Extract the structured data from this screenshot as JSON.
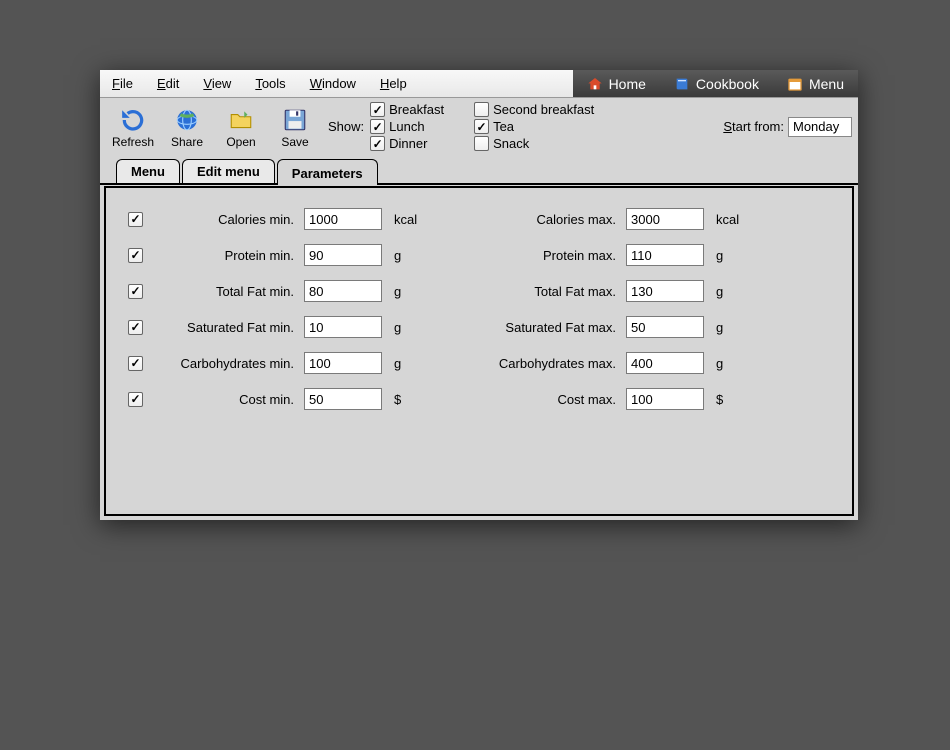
{
  "menubar": {
    "items": [
      {
        "label": "File",
        "u": "F"
      },
      {
        "label": "Edit",
        "u": "E"
      },
      {
        "label": "View",
        "u": "V"
      },
      {
        "label": "Tools",
        "u": "T"
      },
      {
        "label": "Window",
        "u": "W"
      },
      {
        "label": "Help",
        "u": "H"
      }
    ],
    "right": [
      {
        "label": "Home",
        "icon": "home"
      },
      {
        "label": "Cookbook",
        "icon": "book"
      },
      {
        "label": "Menu",
        "icon": "calendar"
      }
    ]
  },
  "toolbar": {
    "buttons": [
      {
        "label": "Refresh",
        "icon": "refresh"
      },
      {
        "label": "Share",
        "icon": "globe"
      },
      {
        "label": "Open",
        "icon": "folder"
      },
      {
        "label": "Save",
        "icon": "floppy"
      }
    ],
    "show_label": "Show:",
    "show": [
      {
        "label": "Breakfast",
        "checked": true
      },
      {
        "label": "Second breakfast",
        "checked": false
      },
      {
        "label": "Lunch",
        "checked": true
      },
      {
        "label": "Tea",
        "checked": true
      },
      {
        "label": "Dinner",
        "checked": true
      },
      {
        "label": "Snack",
        "checked": false
      }
    ],
    "start_label": "Start from:",
    "start_value": "Monday"
  },
  "tabs": [
    "Menu",
    "Edit menu",
    "Parameters"
  ],
  "active_tab": 2,
  "params": [
    {
      "name": "Calories",
      "min": "1000",
      "max": "3000",
      "unit": "kcal",
      "checked": true
    },
    {
      "name": "Protein",
      "min": "90",
      "max": "110",
      "unit": "g",
      "checked": true
    },
    {
      "name": "Total Fat",
      "min": "80",
      "max": "130",
      "unit": "g",
      "checked": true
    },
    {
      "name": "Saturated Fat",
      "min": "10",
      "max": "50",
      "unit": "g",
      "checked": true
    },
    {
      "name": "Carbohydrates",
      "min": "100",
      "max": "400",
      "unit": "g",
      "checked": true
    },
    {
      "name": "Cost",
      "min": "50",
      "max": "100",
      "unit": "$",
      "checked": true
    }
  ],
  "param_labels": {
    "min_suffix": " min.",
    "max_suffix": " max."
  }
}
